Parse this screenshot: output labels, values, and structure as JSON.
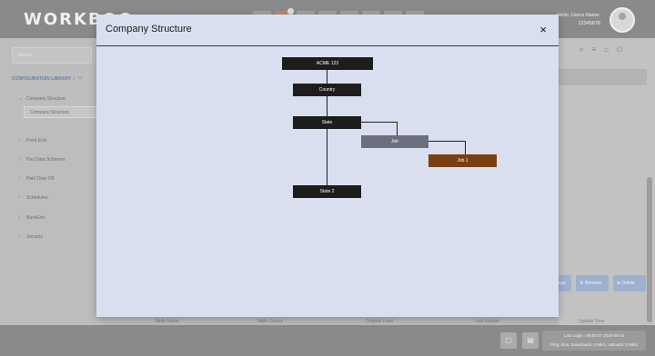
{
  "app": {
    "logo": "WORKBOO",
    "user_greeting": "Hello, Users Name:",
    "user_id": "12345678",
    "search_placeholder": "Search"
  },
  "sidebar": {
    "library_title": "CONFIGURATION LIBRARY",
    "items": [
      {
        "label": "Company Structure"
      },
      {
        "label": "Point End"
      },
      {
        "label": "Pay Data Schemes"
      },
      {
        "label": "Paid Time Off"
      },
      {
        "label": "Schedules"
      },
      {
        "label": "BackEnd"
      },
      {
        "label": "Security"
      }
    ],
    "selected_sub": "Company Structure"
  },
  "right_panel": {
    "buttons": [
      "...lean",
      "Rename",
      "Delete"
    ]
  },
  "table": {
    "columns": [
      "Table Name",
      "Table Counts",
      "Original Load",
      "Last Update",
      "Update Time"
    ]
  },
  "footer": {
    "last_login": "Last Login : 08:00:27 2024-00-13",
    "ping": "Ping: 0ms, Downloads: 0 Mb/s, Uploads: 0 Mb/s"
  },
  "modal": {
    "title": "Company Structure",
    "close_label": "×",
    "nodes": {
      "root": "ACME 123",
      "country": "Country",
      "state": "State",
      "job": "Job",
      "job1": "Job 1",
      "state2": "State 2"
    },
    "colors": {
      "node_dark": "#1d1d1d",
      "node_gray": "#6d707c",
      "node_selected": "#7a3e13",
      "modal_bg": "#dadff0"
    }
  }
}
